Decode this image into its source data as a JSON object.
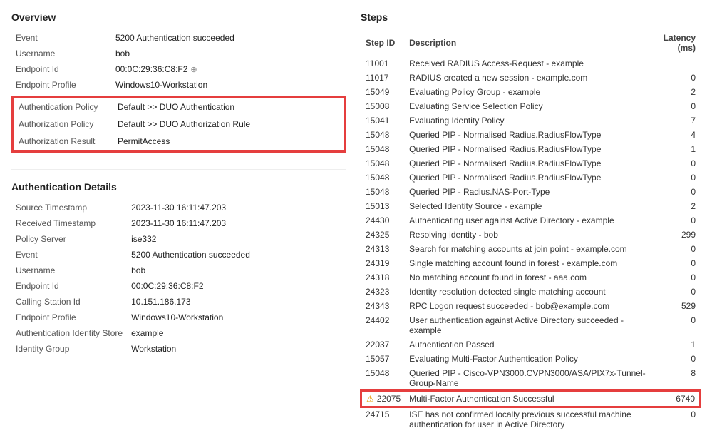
{
  "overview": {
    "title": "Overview",
    "fields": [
      {
        "label": "Event",
        "value": "5200 Authentication succeeded",
        "green": true
      },
      {
        "label": "Username",
        "value": "bob",
        "green": false
      },
      {
        "label": "Endpoint Id",
        "value": "00:0C:29:36:C8:F2",
        "green": false,
        "copy": true
      },
      {
        "label": "Endpoint Profile",
        "value": "Windows10-Workstation",
        "green": false
      }
    ],
    "highlighted_fields": [
      {
        "label": "Authentication Policy",
        "value": "Default >> DUO Authentication",
        "green": false
      },
      {
        "label": "Authorization Policy",
        "value": "Default >> DUO Authorization Rule",
        "green": false
      },
      {
        "label": "Authorization Result",
        "value": "PermitAccess",
        "green": false
      }
    ]
  },
  "auth_details": {
    "title": "Authentication Details",
    "fields": [
      {
        "label": "Source Timestamp",
        "value": "2023-11-30 16:11:47.203",
        "green": false
      },
      {
        "label": "Received Timestamp",
        "value": "2023-11-30 16:11:47.203",
        "green": false
      },
      {
        "label": "Policy Server",
        "value": "ise332",
        "green": false
      },
      {
        "label": "Event",
        "value": "5200 Authentication succeeded",
        "green": true
      },
      {
        "label": "Username",
        "value": "bob",
        "green": false
      },
      {
        "label": "Endpoint Id",
        "value": "00:0C:29:36:C8:F2",
        "green": false
      },
      {
        "label": "Calling Station Id",
        "value": "10.151.186.173",
        "green": false
      },
      {
        "label": "Endpoint Profile",
        "value": "Windows10-Workstation",
        "green": false
      },
      {
        "label": "Authentication Identity Store",
        "value": "example",
        "green": false
      },
      {
        "label": "Identity Group",
        "value": "Workstation",
        "green": false
      }
    ]
  },
  "steps": {
    "title": "Steps",
    "columns": [
      "Step ID",
      "Description",
      "Latency (ms)"
    ],
    "rows": [
      {
        "id": "11001",
        "description": "Received RADIUS Access-Request - example",
        "latency": ""
      },
      {
        "id": "11017",
        "description": "RADIUS created a new session - example.com",
        "latency": "0"
      },
      {
        "id": "15049",
        "description": "Evaluating Policy Group - example",
        "latency": "2"
      },
      {
        "id": "15008",
        "description": "Evaluating Service Selection Policy",
        "latency": "0"
      },
      {
        "id": "15041",
        "description": "Evaluating Identity Policy",
        "latency": "7"
      },
      {
        "id": "15048",
        "description": "Queried PIP - Normalised Radius.RadiusFlowType",
        "latency": "4"
      },
      {
        "id": "15048",
        "description": "Queried PIP - Normalised Radius.RadiusFlowType",
        "latency": "1"
      },
      {
        "id": "15048",
        "description": "Queried PIP - Normalised Radius.RadiusFlowType",
        "latency": "0"
      },
      {
        "id": "15048",
        "description": "Queried PIP - Normalised Radius.RadiusFlowType",
        "latency": "0"
      },
      {
        "id": "15048",
        "description": "Queried PIP - Radius.NAS-Port-Type",
        "latency": "0"
      },
      {
        "id": "15013",
        "description": "Selected Identity Source - example",
        "latency": "2"
      },
      {
        "id": "24430",
        "description": "Authenticating user against Active Directory - example",
        "latency": "0"
      },
      {
        "id": "24325",
        "description": "Resolving identity - bob",
        "latency": "299"
      },
      {
        "id": "24313",
        "description": "Search for matching accounts at join point - example.com",
        "latency": "0"
      },
      {
        "id": "24319",
        "description": "Single matching account found in forest - example.com",
        "latency": "0"
      },
      {
        "id": "24318",
        "description": "No matching account found in forest - aaa.com",
        "latency": "0"
      },
      {
        "id": "24323",
        "description": "Identity resolution detected single matching account",
        "latency": "0"
      },
      {
        "id": "24343",
        "description": "RPC Logon request succeeded - bob@example.com",
        "latency": "529"
      },
      {
        "id": "24402",
        "description": "User authentication against Active Directory succeeded - example",
        "latency": "0"
      },
      {
        "id": "22037",
        "description": "Authentication Passed",
        "latency": "1"
      },
      {
        "id": "15057",
        "description": "Evaluating Multi-Factor Authentication Policy",
        "latency": "0"
      },
      {
        "id": "15048",
        "description": "Queried PIP - Cisco-VPN3000.CVPN3000/ASA/PIX7x-Tunnel-Group-Name",
        "latency": "8"
      },
      {
        "id": "22075",
        "description": "Multi-Factor Authentication Successful",
        "latency": "6740",
        "highlighted": true,
        "warn": true
      },
      {
        "id": "24715",
        "description": "ISE has not confirmed locally previous successful machine authentication for user in Active Directory",
        "latency": "0"
      }
    ]
  }
}
